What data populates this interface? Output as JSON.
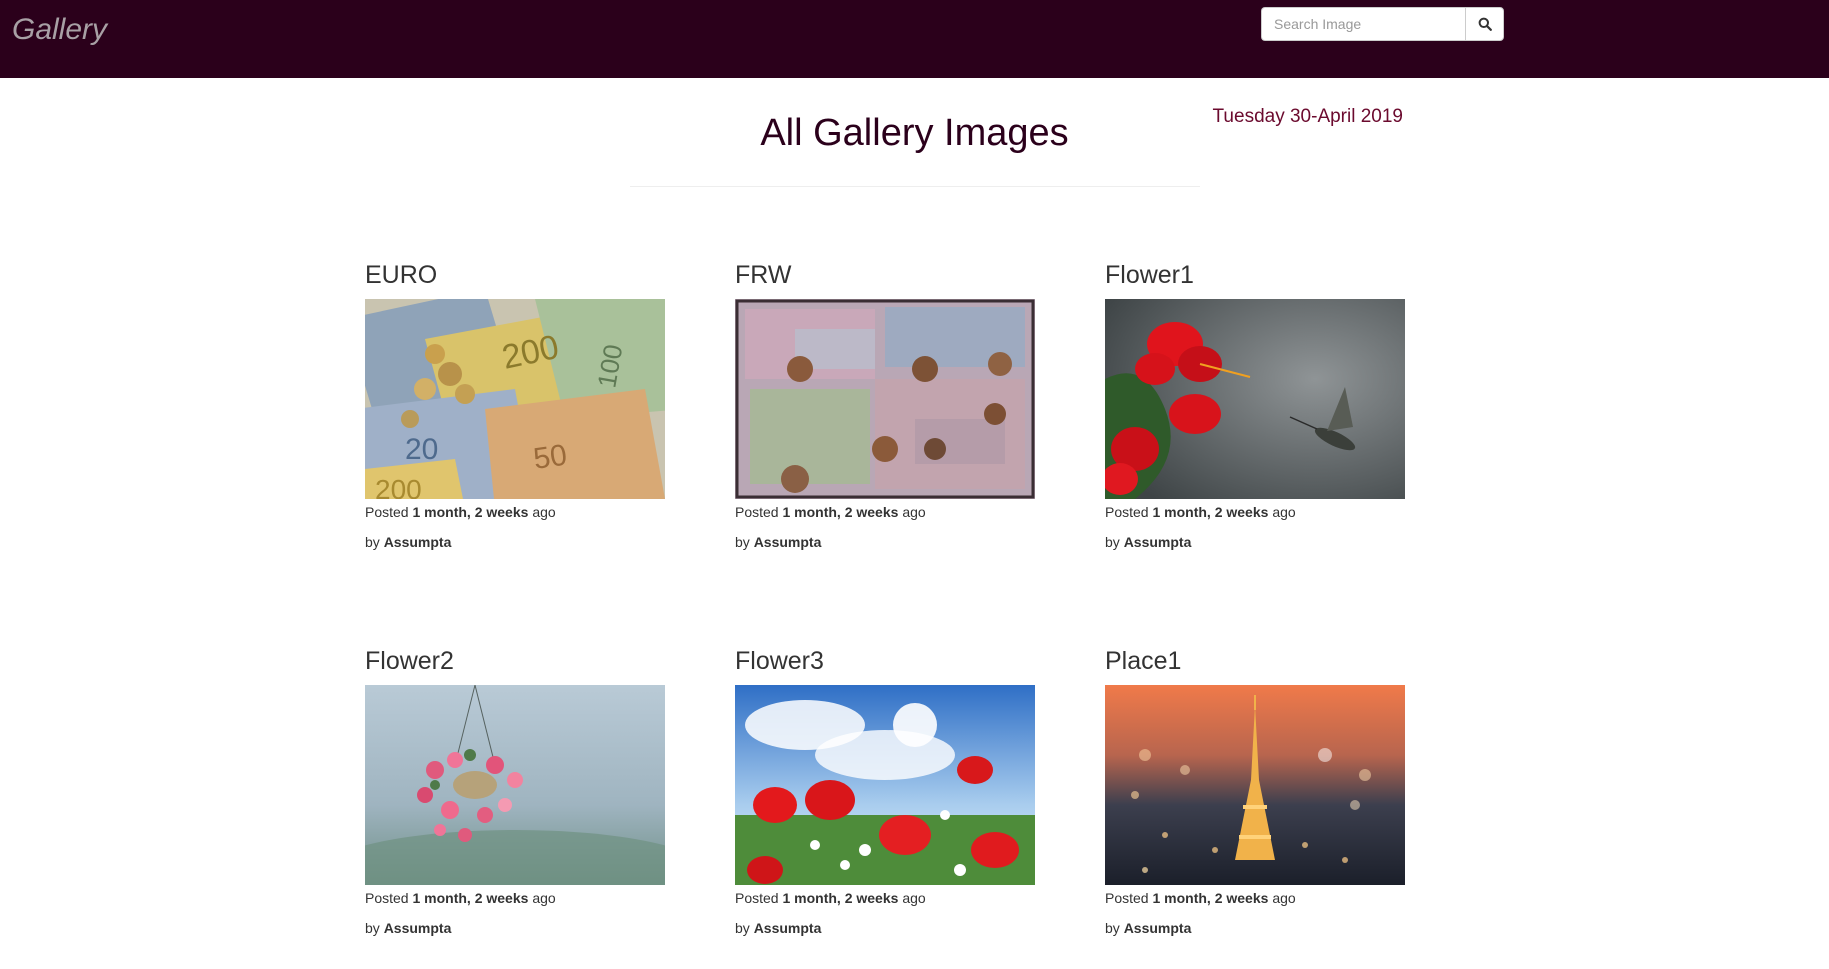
{
  "navbar": {
    "brand": "Gallery",
    "search": {
      "placeholder": "Search Image",
      "button_icon": "search-icon"
    }
  },
  "header": {
    "title": "All Gallery Images",
    "date": "Tuesday 30-April 2019"
  },
  "colors": {
    "navbar_bg": "#2b001b",
    "title": "#2b001b",
    "date": "#6b0a2e"
  },
  "images": [
    {
      "title": "EURO",
      "posted_prefix": "Posted",
      "posted_age": "1 month, 2 weeks",
      "posted_suffix": "ago",
      "by_prefix": "by",
      "author": "Assumpta"
    },
    {
      "title": "FRW",
      "posted_prefix": "Posted",
      "posted_age": "1 month, 2 weeks",
      "posted_suffix": "ago",
      "by_prefix": "by",
      "author": "Assumpta"
    },
    {
      "title": "Flower1",
      "posted_prefix": "Posted",
      "posted_age": "1 month, 2 weeks",
      "posted_suffix": "ago",
      "by_prefix": "by",
      "author": "Assumpta"
    },
    {
      "title": "Flower2",
      "posted_prefix": "Posted",
      "posted_age": "1 month, 2 weeks",
      "posted_suffix": "ago",
      "by_prefix": "by",
      "author": "Assumpta"
    },
    {
      "title": "Flower3",
      "posted_prefix": "Posted",
      "posted_age": "1 month, 2 weeks",
      "posted_suffix": "ago",
      "by_prefix": "by",
      "author": "Assumpta"
    },
    {
      "title": "Place1",
      "posted_prefix": "Posted",
      "posted_age": "1 month, 2 weeks",
      "posted_suffix": "ago",
      "by_prefix": "by",
      "author": "Assumpta"
    }
  ]
}
